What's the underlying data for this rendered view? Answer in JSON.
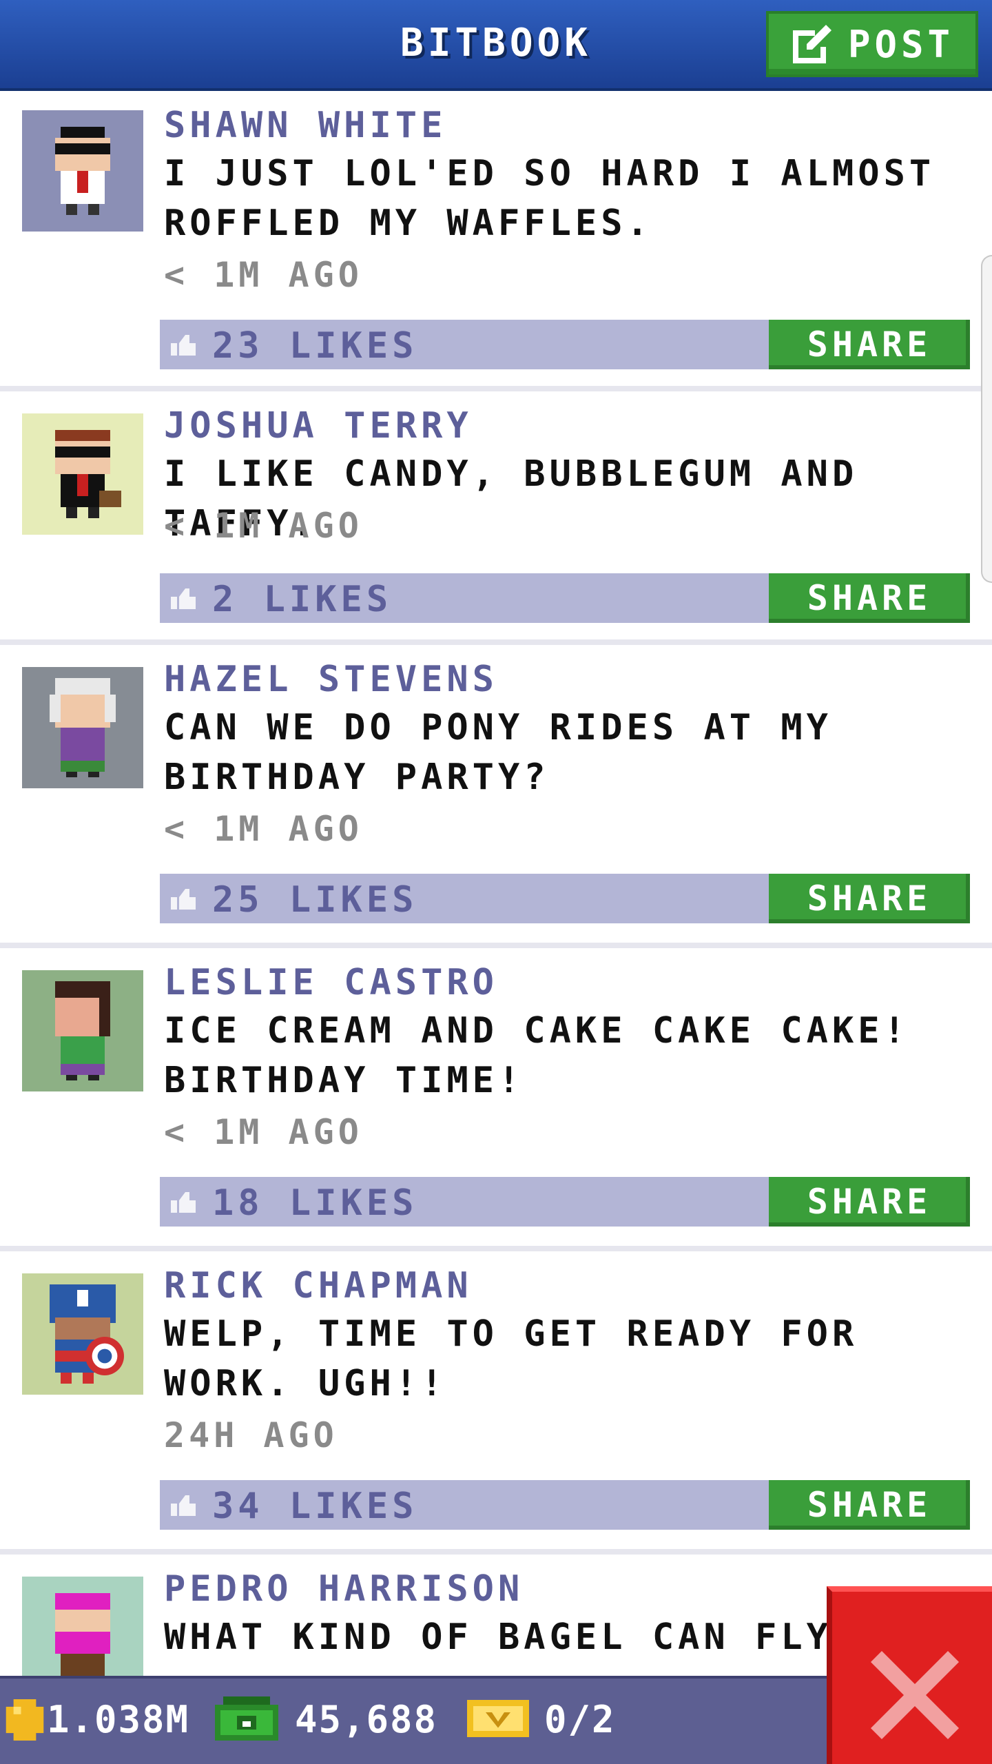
{
  "header": {
    "title": "BITBOOK",
    "post_label": "POST"
  },
  "posts": [
    {
      "author": "SHAWN WHITE",
      "message": "I JUST LOL'ED SO HARD I ALMOST ROFFLED MY WAFFLES.",
      "time": "< 1M AGO",
      "likes": "23 LIKES",
      "share": "SHARE",
      "avatar_bg": "#8b8fb5"
    },
    {
      "author": "JOSHUA TERRY",
      "message": "I LIKE CANDY, BUBBLEGUM AND TAFFY.",
      "time": "< 1M AGO",
      "likes": "2 LIKES",
      "share": "SHARE",
      "avatar_bg": "#e6ecb8"
    },
    {
      "author": "HAZEL STEVENS",
      "message": "CAN WE DO PONY RIDES AT MY BIRTHDAY PARTY?",
      "time": "< 1M AGO",
      "likes": "25 LIKES",
      "share": "SHARE",
      "avatar_bg": "#868c94"
    },
    {
      "author": "LESLIE CASTRO",
      "message": "ICE CREAM AND CAKE CAKE CAKE! BIRTHDAY TIME!",
      "time": "< 1M AGO",
      "likes": "18 LIKES",
      "share": "SHARE",
      "avatar_bg": "#8db085"
    },
    {
      "author": "RICK CHAPMAN",
      "message": "WELP, TIME TO GET READY FOR WORK. UGH!!",
      "time": "24H AGO",
      "likes": "34 LIKES",
      "share": "SHARE",
      "avatar_bg": "#c5d49c"
    },
    {
      "author": "PEDRO HARRISON",
      "message": "WHAT KIND OF BAGEL CAN FLY?",
      "time": "",
      "likes": "",
      "share": "",
      "avatar_bg": "#a9d3c0"
    }
  ],
  "bottom_bar": {
    "coins": "1.038M",
    "bux": "45,688",
    "vip": "0/2"
  },
  "colors": {
    "header_blue": "#2348a6",
    "accent_green": "#3a9e3a",
    "like_bar": "#b3b5d6",
    "author_purple": "#5d5f9a",
    "close_red": "#e02020"
  },
  "icons": {
    "post": "edit-icon",
    "like": "thumbs-up-icon",
    "coin": "coin-icon",
    "bux": "bux-icon",
    "vip": "vip-ticket-icon",
    "close": "close-icon"
  }
}
